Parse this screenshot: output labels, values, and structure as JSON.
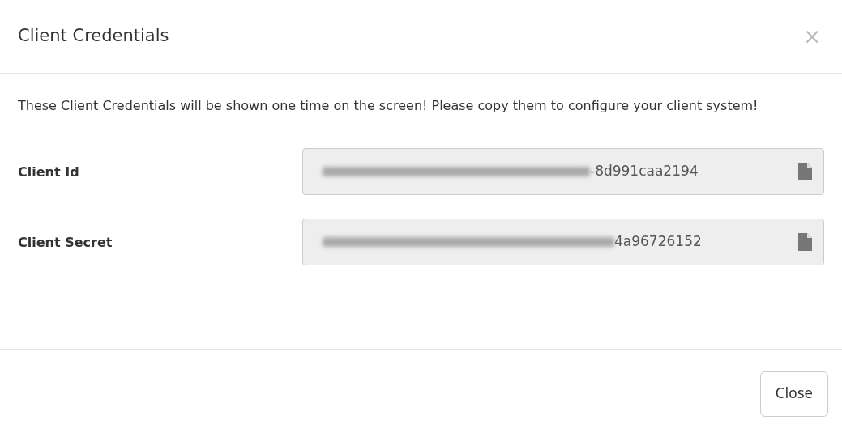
{
  "modal": {
    "title": "Client Credentials",
    "close_symbol": "×"
  },
  "message": "These Client Credentials will be shown one time on the screen! Please copy them to configure your client system!",
  "fields": [
    {
      "label": "Client Id",
      "visible_value": "-8d991caa2194"
    },
    {
      "label": "Client Secret",
      "visible_value": "4a96726152"
    }
  ],
  "footer": {
    "button": "Close"
  }
}
